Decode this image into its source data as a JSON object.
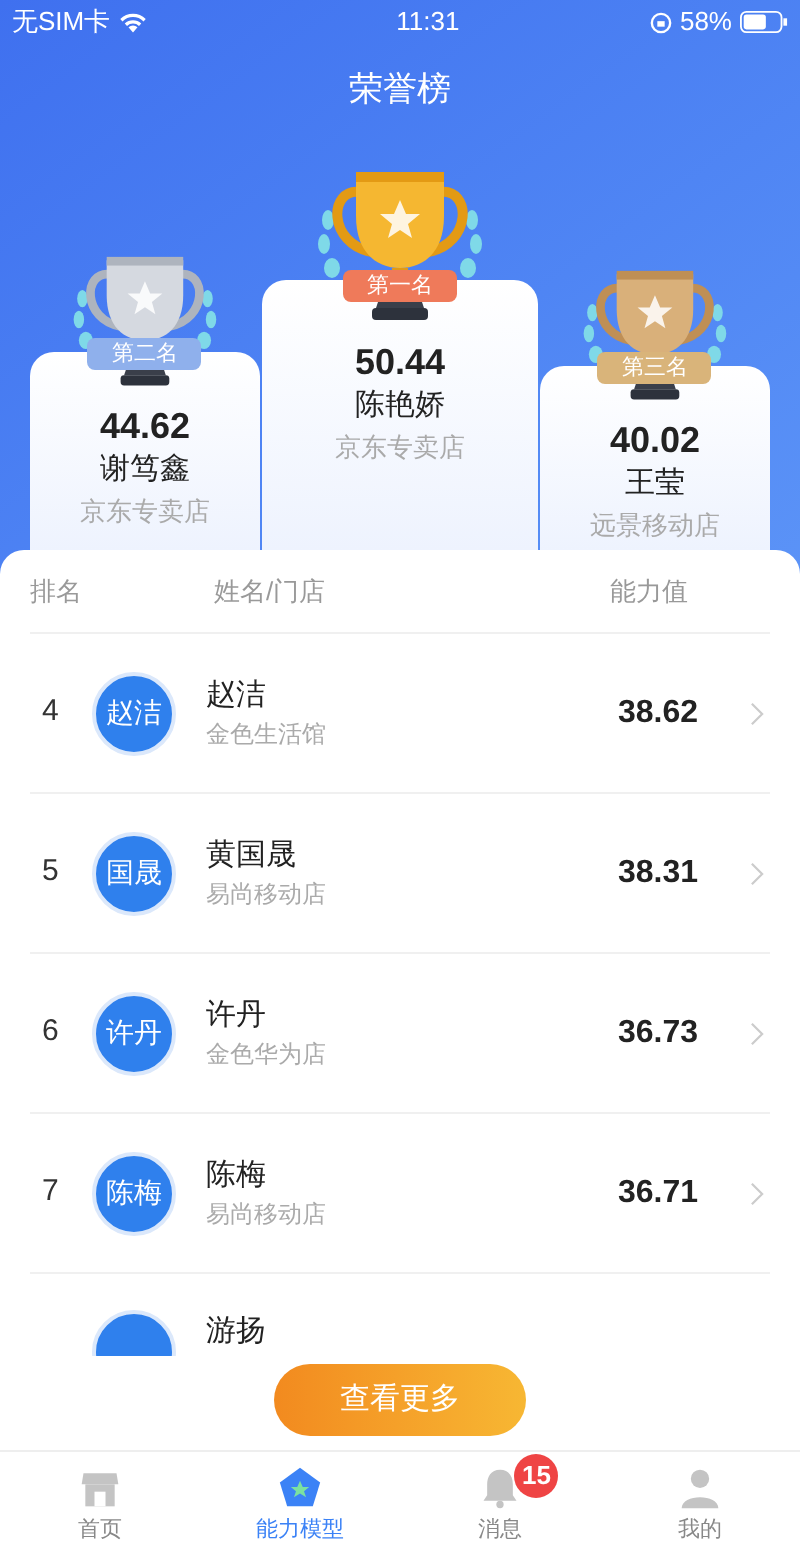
{
  "status_bar": {
    "carrier": "无SIM卡",
    "time": "11:31",
    "battery": "58%"
  },
  "title": "荣誉榜",
  "podium": [
    {
      "kind": "silver",
      "badge": "第二名",
      "score": "44.62",
      "name": "谢笃鑫",
      "store": "京东专卖店"
    },
    {
      "kind": "gold",
      "badge": "第一名",
      "score": "50.44",
      "name": "陈艳娇",
      "store": "京东专卖店"
    },
    {
      "kind": "bronze",
      "badge": "第三名",
      "score": "40.02",
      "name": "王莹",
      "store": "远景移动店"
    }
  ],
  "table": {
    "columns": [
      "排名",
      "姓名/门店",
      "能力值"
    ],
    "rows": [
      {
        "rank": "4",
        "avatar": "赵洁",
        "name": "赵洁",
        "store": "金色生活馆",
        "score": "38.62"
      },
      {
        "rank": "5",
        "avatar": "国晟",
        "name": "黄国晟",
        "store": "易尚移动店",
        "score": "38.31"
      },
      {
        "rank": "6",
        "avatar": "许丹",
        "name": "许丹",
        "store": "金色华为店",
        "score": "36.73"
      },
      {
        "rank": "7",
        "avatar": "陈梅",
        "name": "陈梅",
        "store": "易尚移动店",
        "score": "36.71"
      },
      {
        "name": "游扬"
      }
    ]
  },
  "more_button": "查看更多",
  "tab_bar": [
    {
      "kind": "home",
      "label": "首页",
      "selected": false
    },
    {
      "kind": "model",
      "label": "能力模型",
      "selected": true
    },
    {
      "kind": "messages",
      "label": "消息",
      "selected": false,
      "badge": "15"
    },
    {
      "kind": "me",
      "label": "我的",
      "selected": false
    }
  ]
}
